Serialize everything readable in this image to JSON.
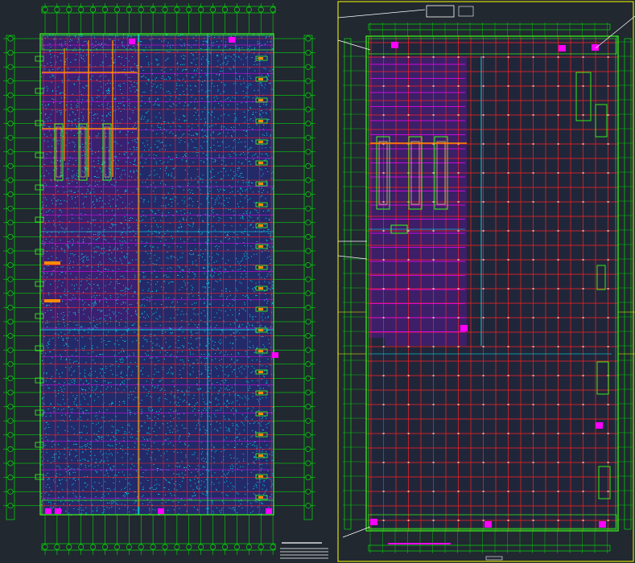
{
  "drawing": {
    "background": "#212830",
    "colors": {
      "grid_axis": "#00ff00",
      "column_line": "#ff2020",
      "beam": "#ff00ff",
      "fill_pattern": "#00e5ff",
      "orange": "#ff8a00",
      "cyan": "#00ffff",
      "yellow_frame": "#ffff00",
      "white": "#ffffff",
      "green_bright": "#39ff14"
    },
    "left_plan": {
      "title_block_lines": 4
    },
    "right_plan": {
      "frame_color": "#ffff00"
    }
  }
}
